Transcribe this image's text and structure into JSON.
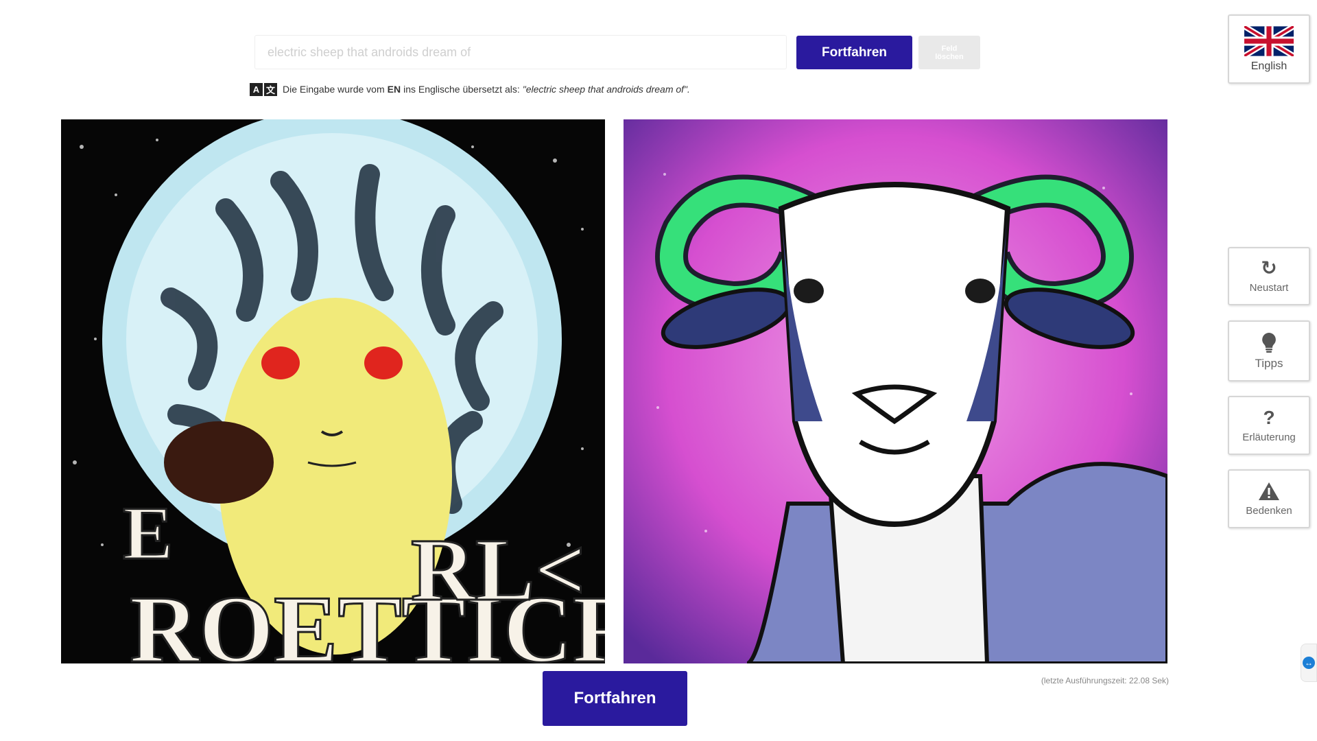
{
  "search": {
    "placeholder": "electric sheep that androids dream of",
    "submit_label": "Fortfahren",
    "clear_label": "Feld\nlöschen"
  },
  "translation": {
    "icon": "translate-icon",
    "text_before": "Die Eingabe wurde vom",
    "source_lang": "EN",
    "text_after": "ins Englische übersetzt als:",
    "translated": "\"electric sheep that androids dream of\"."
  },
  "images": [
    {
      "name": "generated-image-1",
      "description": "glowing alien figure with distorted lettering"
    },
    {
      "name": "generated-image-2",
      "description": "ram with green horns on pink nebula"
    }
  ],
  "main": {
    "continue_label": "Fortfahren",
    "runtime": "(letzte Ausführungszeit: 22.08 Sek)"
  },
  "sidebar": {
    "language": {
      "label": "English",
      "icon": "uk-flag-icon"
    },
    "restart": {
      "label": "Neustart",
      "icon": "restart-icon"
    },
    "tips": {
      "label": "Tipps",
      "icon": "lightbulb-icon"
    },
    "explanation": {
      "label": "Erläuterung",
      "icon": "question-icon"
    },
    "concerns": {
      "label": "Bedenken",
      "icon": "warning-icon"
    }
  },
  "colors": {
    "primary": "#2a1a9e",
    "disabled": "#e9e9e9"
  }
}
